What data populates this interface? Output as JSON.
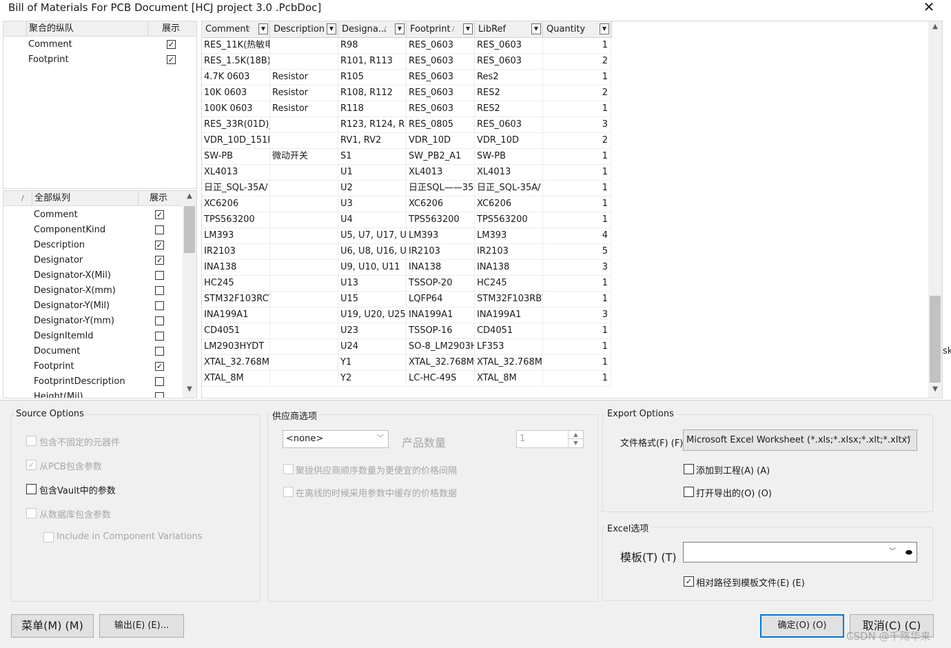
{
  "window": {
    "title": "Bill of Materials For PCB Document [HCJ project 3.0 .PcbDoc]",
    "close_glyph": "✕"
  },
  "grouped_columns": {
    "header": "聚合的纵队",
    "show_header": "展示",
    "items": [
      {
        "label": "Comment",
        "checked": true
      },
      {
        "label": "Footprint",
        "checked": true
      }
    ]
  },
  "all_columns": {
    "sort_glyph": "/",
    "header": "全部纵列",
    "show_header": "展示",
    "items": [
      {
        "label": "Comment",
        "checked": true
      },
      {
        "label": "ComponentKind",
        "checked": false
      },
      {
        "label": "Description",
        "checked": true
      },
      {
        "label": "Designator",
        "checked": true
      },
      {
        "label": "Designator-X(Mil)",
        "checked": false
      },
      {
        "label": "Designator-X(mm)",
        "checked": false
      },
      {
        "label": "Designator-Y(Mil)",
        "checked": false
      },
      {
        "label": "Designator-Y(mm)",
        "checked": false
      },
      {
        "label": "DesignItemId",
        "checked": false
      },
      {
        "label": "Document",
        "checked": false
      },
      {
        "label": "Footprint",
        "checked": true
      },
      {
        "label": "FootprintDescription",
        "checked": false
      },
      {
        "label": "Height(Mil)",
        "checked": false
      }
    ]
  },
  "bom_table": {
    "columns": [
      {
        "label": "Comment",
        "sort": "/"
      },
      {
        "label": "Description",
        "sort": ""
      },
      {
        "label": "Designa...",
        "sort": "/"
      },
      {
        "label": "Footprint",
        "sort": "/"
      },
      {
        "label": "LibRef",
        "sort": ""
      },
      {
        "label": "Quantity",
        "sort": ""
      }
    ],
    "rows": [
      [
        "RES_11K(热敏电",
        "",
        "R98",
        "RES_0603",
        "RES_0603",
        "1"
      ],
      [
        "RES_1.5K(18B)_(",
        "",
        "R101, R113",
        "RES_0603",
        "RES_0603",
        "2"
      ],
      [
        "4.7K 0603",
        "Resistor",
        "R105",
        "RES_0603",
        "Res2",
        "1"
      ],
      [
        "10K 0603",
        "Resistor",
        "R108, R112",
        "RES_0603",
        "RES2",
        "2"
      ],
      [
        "100K 0603",
        "Resistor",
        "R118",
        "RES_0603",
        "RES2",
        "1"
      ],
      [
        "RES_33R(01D)_(",
        "",
        "R123, R124, R1",
        "RES_0805",
        "RES_0603",
        "3"
      ],
      [
        "VDR_10D_151K",
        "",
        "RV1, RV2",
        "VDR_10D",
        "VDR_10D",
        "2"
      ],
      [
        "SW-PB",
        "微动开关",
        "S1",
        "SW_PB2_A1",
        "SW-PB",
        "1"
      ],
      [
        "XL4013",
        "",
        "U1",
        "XL4013",
        "XL4013",
        "1"
      ],
      [
        "日正_SQL-35A/",
        "",
        "U2",
        "日正SQL——35",
        "日正_SQL-35A/",
        "1"
      ],
      [
        "XC6206",
        "",
        "U3",
        "XC6206",
        "XC6206",
        "1"
      ],
      [
        "TPS563200",
        "",
        "U4",
        "TPS563200",
        "TPS563200",
        "1"
      ],
      [
        "LM393",
        "",
        "U5, U7, U17, U:",
        "LM393",
        "LM393",
        "4"
      ],
      [
        "IR2103",
        "",
        "U6, U8, U16, U",
        "IR2103",
        "IR2103",
        "5"
      ],
      [
        "INA138",
        "",
        "U9, U10, U11",
        "INA138",
        "INA138",
        "3"
      ],
      [
        "HC245",
        "",
        "U13",
        "TSSOP-20",
        "HC245",
        "1"
      ],
      [
        "STM32F103RCT",
        "",
        "U15",
        "LQFP64",
        "STM32F103RBT",
        "1"
      ],
      [
        "INA199A1",
        "",
        "U19, U20, U25",
        "INA199A1",
        "INA199A1",
        "3"
      ],
      [
        "CD4051",
        "",
        "U23",
        "TSSOP-16",
        "CD4051",
        "1"
      ],
      [
        "LM2903HYDT",
        "",
        "U24",
        "SO-8_LM2903H",
        "LF353",
        "1"
      ],
      [
        "XTAL_32.768M",
        "",
        "Y1",
        "XTAL_32.768M",
        "XTAL_32.768M",
        "1"
      ],
      [
        "XTAL_8M",
        "",
        "Y2",
        "LC-HC-49S",
        "XTAL_8M",
        "1"
      ]
    ]
  },
  "source_options": {
    "title": "Source Options",
    "items": [
      {
        "label": "包含不固定的元器件",
        "checked": false,
        "enabled": false
      },
      {
        "label": "从PCB包含参数",
        "checked": true,
        "enabled": false
      },
      {
        "label": "包含Vault中的参数",
        "checked": false,
        "enabled": true
      },
      {
        "label": "从数据库包含参数",
        "checked": false,
        "enabled": false
      },
      {
        "label": "Include in Component Variations",
        "checked": false,
        "enabled": false
      }
    ]
  },
  "supplier_options": {
    "title": "供应商选项",
    "supplier_value": "<none>",
    "qty_label": "产品数量",
    "qty_value": "1",
    "items": [
      {
        "label": "聚拢供应商顺序数量为更便宜的价格间隔",
        "checked": false
      },
      {
        "label": "在离线的时候采用参数中缓存的价格数据",
        "checked": false
      }
    ]
  },
  "export_options": {
    "title": "Export Options",
    "format_label": "文件格式(F) (F)",
    "format_value": "Microsoft Excel Worksheet (*.xls;*.xlsx;*.xlt;*.xltx)",
    "add_to_project": "添加到工程(A) (A)",
    "open_exported": "打开导出的(O) (O)"
  },
  "excel_options": {
    "title": "Excel选项",
    "template_label": "模板(T) (T)",
    "template_value": "",
    "relative_path": "相对路径到模板文件(E) (E)",
    "relative_path_checked": true
  },
  "buttons": {
    "menu": "菜单(M) (M)",
    "export": "输出(E) (E)...",
    "ok": "确定(O) (O)",
    "cancel": "取消(C) (C)"
  },
  "edge_text": "sk",
  "watermark": "CSDN @千殇华来"
}
